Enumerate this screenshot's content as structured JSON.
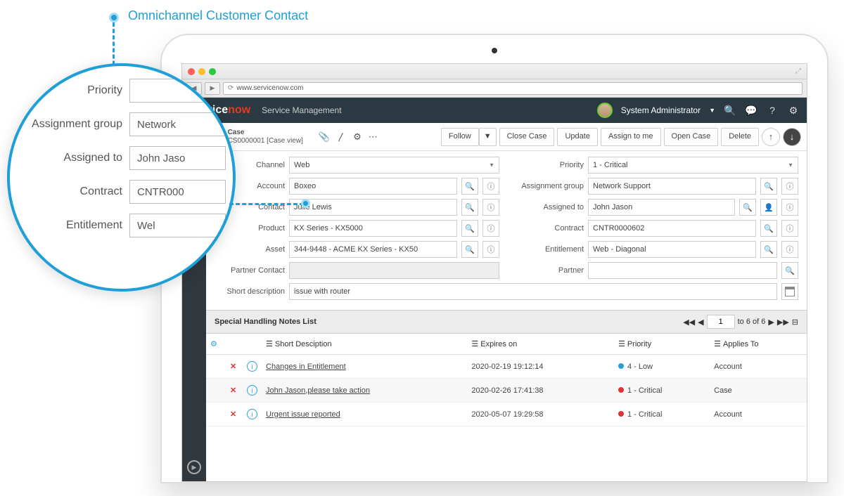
{
  "annotation": {
    "text": "Omnichannel Customer Contact"
  },
  "browser": {
    "url": "www.servicenow.com"
  },
  "header": {
    "logo_prefix": "service",
    "logo_suffix": "now",
    "service": "Service Management",
    "user": "System Administrator"
  },
  "case": {
    "label": "Case",
    "number": "CS0000001 [Case view]",
    "buttons": [
      "Follow",
      "Close Case",
      "Update",
      "Assign to me",
      "Open Case",
      "Delete"
    ]
  },
  "form": {
    "channel_label": "Channel",
    "channel": "Web",
    "account_label": "Account",
    "account": "Boxeo",
    "contact_label": "Contact",
    "contact": "Julie Lewis",
    "product_label": "Product",
    "product": "KX Series - KX5000",
    "asset_label": "Asset",
    "asset": "344-9448 - ACME KX Series - KX50",
    "partner_contact_label": "Partner Contact",
    "partner_contact": "",
    "priority_label": "Priority",
    "priority": "1 - Critical",
    "assignment_group_label": "Assignment group",
    "assignment_group": "Network Support",
    "assigned_to_label": "Assigned to",
    "assigned_to": "John Jason",
    "contract_label": "Contract",
    "contract": "CNTR0000602",
    "entitlement_label": "Entitlement",
    "entitlement": "Web - Diagonal",
    "partner_label": "Partner",
    "partner": "",
    "short_desc_label": "Short description",
    "short_desc": "issue with router"
  },
  "zoom": {
    "priority_label": "Priority",
    "assignment_group_label": "Assignment group",
    "assignment_group": "Network",
    "assigned_to_label": "Assigned to",
    "assigned_to": "John Jaso",
    "contract_label": "Contract",
    "contract": "CNTR000",
    "entitlement_label": "Entitlement",
    "entitlement": "Wel"
  },
  "notes": {
    "title": "Special Handling Notes List",
    "page": "1",
    "range": "to 6 of 6",
    "columns": {
      "short_desc": "Short Desciption",
      "expires": "Expires on",
      "priority": "Priority",
      "applies": "Applies To"
    },
    "rows": [
      {
        "desc": "Changes in Entitlement",
        "expires": "2020-02-19 19:12:14",
        "priority": "4 - Low",
        "pri_color": "#2b9ed6",
        "applies": "Account"
      },
      {
        "desc": "John Jason,please take action",
        "expires": "2020-02-26 17:41:38",
        "priority": "1 - Critical",
        "pri_color": "#d33",
        "applies": "Case"
      },
      {
        "desc": "Urgent issue reported",
        "expires": "2020-05-07 19:29:58",
        "priority": "1 - Critical",
        "pri_color": "#d33",
        "applies": "Account"
      }
    ]
  }
}
